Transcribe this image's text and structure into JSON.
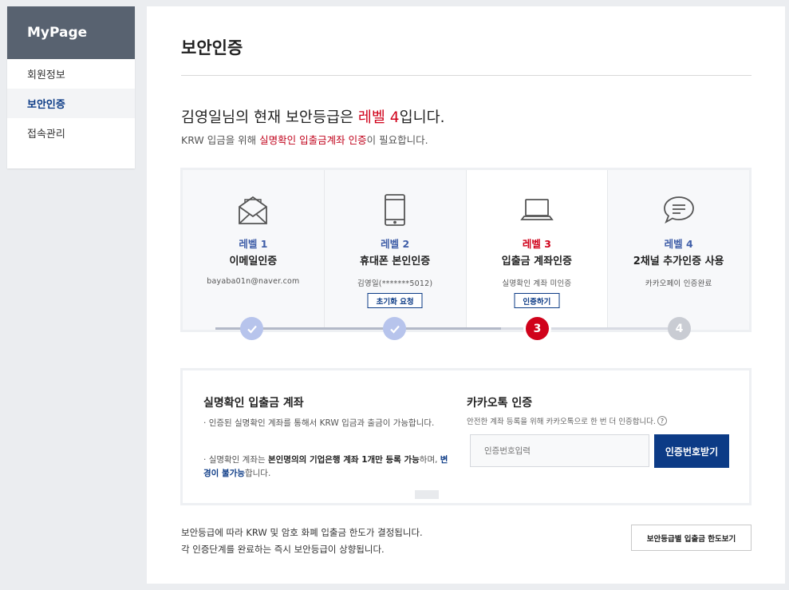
{
  "sidebar": {
    "title": "MyPage",
    "items": [
      {
        "label": "회원정보",
        "active": false
      },
      {
        "label": "보안인증",
        "active": true
      },
      {
        "label": "접속관리",
        "active": false
      }
    ]
  },
  "page": {
    "title": "보안인증",
    "status_prefix": "김영일님의 현재 보안등급은 ",
    "status_level": "레벨 4",
    "status_suffix": "입니다.",
    "sub_prefix": "KRW 입금을 위해 ",
    "sub_highlight": "실명확인 입출금계좌 인증",
    "sub_suffix": "이 필요합니다."
  },
  "levels": [
    {
      "level": "레벨 1",
      "name": "이메일인증",
      "detail": "bayaba01n@naver.com",
      "button": "",
      "icon": "envelope-icon",
      "state": "done"
    },
    {
      "level": "레벨 2",
      "name": "휴대폰 본인인증",
      "detail": "김영일(*******5012)",
      "button": "초기화 요청",
      "icon": "smartphone-icon",
      "state": "done"
    },
    {
      "level": "레벨 3",
      "name": "입출금 계좌인증",
      "detail": "실명확인 계좌 미인증",
      "button": "인증하기",
      "icon": "laptop-icon",
      "state": "current",
      "step": "3"
    },
    {
      "level": "레벨 4",
      "name": "2채널 추가인증 사용",
      "detail": "카카오페이 인증완료",
      "button": "",
      "icon": "chat-bubble-icon",
      "state": "todo",
      "step": "4"
    }
  ],
  "account": {
    "title": "실명확인 입출금 계좌",
    "note1": "인증된 실명확인 계좌를 통해서 KRW 입금과 출금이 가능합니다.",
    "note2_a": "실명확인 계좌는 ",
    "note2_b": "본인명의의 기업은행 계좌 1개만 등록 가능",
    "note2_c": "하며, ",
    "note2_d": "변경이 불가능",
    "note2_e": "합니다."
  },
  "kakao": {
    "title": "카카오톡 인증",
    "desc": "안전한 계좌 등록을 위해 카카오톡으로 한 번 더 인증합니다.",
    "help": "?",
    "input_placeholder": "인증번호입력",
    "button": "인증번호받기"
  },
  "footer": {
    "line1": "보안등급에 따라 KRW 및 암호 화폐 입출금 한도가 결정됩니다.",
    "line2": "각 인증단계를 완료하는 즉시 보안등급이 상향됩니다.",
    "button": "보안등급별 입출금 한도보기"
  },
  "colors": {
    "navy": "#0c3b86",
    "red": "#d0021b",
    "sidebar_head": "#586270",
    "done_step": "#b7c4ec"
  }
}
